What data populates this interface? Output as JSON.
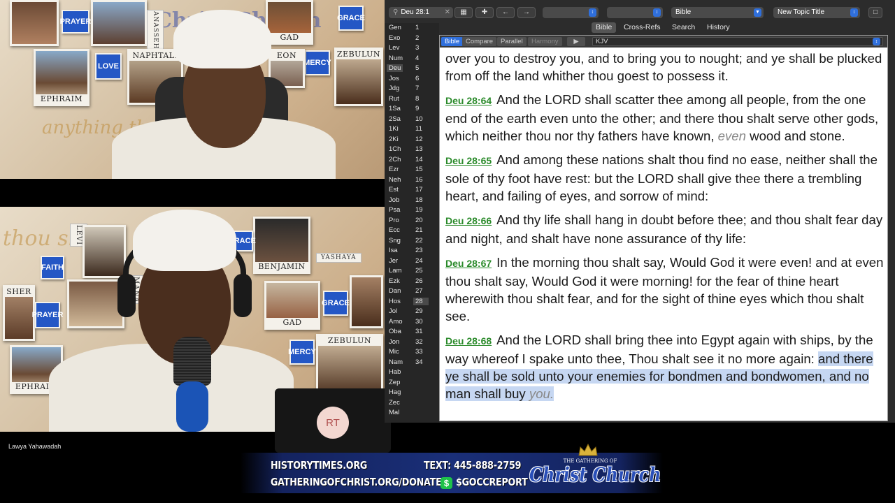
{
  "video_call": {
    "participant_name": "Lawya Yahawadah",
    "avatar_initials": "RT",
    "top_wall": {
      "tags": [
        "PRAYER",
        "LOVE",
        "GRACE",
        "MERCY"
      ],
      "photo_labels": [
        "EPHRAIM",
        "NAPHTALI",
        "GAD",
        "ZEBULUN",
        "EON"
      ],
      "side_label": "ANASSEH",
      "wall_title": "Christ Church",
      "wall_script": "anything that is"
    },
    "bottom_wall": {
      "tags": [
        "FAITH",
        "PRAYER",
        "MERCY",
        "GRACE"
      ],
      "photo_labels": [
        "BENJAMIN",
        "GAD",
        "ZEBULUN",
        "EPHRAIM"
      ],
      "side_labels": [
        "LEVI",
        "MANA",
        "SHER",
        "YASHAYA"
      ],
      "wall_script": "thou shalt"
    }
  },
  "bible_app": {
    "reference_field": "Deu 28:1",
    "module_select": "Bible",
    "layout_select": "New Topic Title",
    "top_tabs": [
      "Bible",
      "Cross-Refs",
      "Search",
      "History"
    ],
    "active_top_tab": "Bible",
    "sub_tabs": [
      "Bible",
      "Compare",
      "Parallel",
      "Harmony"
    ],
    "version": "KJV",
    "books": [
      {
        "name": "Gen",
        "ch": "1"
      },
      {
        "name": "Exo",
        "ch": "2"
      },
      {
        "name": "Lev",
        "ch": "3"
      },
      {
        "name": "Num",
        "ch": "4"
      },
      {
        "name": "Deu",
        "ch": "5"
      },
      {
        "name": "Jos",
        "ch": "6"
      },
      {
        "name": "Jdg",
        "ch": "7"
      },
      {
        "name": "Rut",
        "ch": "8"
      },
      {
        "name": "1Sa",
        "ch": "9"
      },
      {
        "name": "2Sa",
        "ch": "10"
      },
      {
        "name": "1Ki",
        "ch": "11"
      },
      {
        "name": "2Ki",
        "ch": "12"
      },
      {
        "name": "1Ch",
        "ch": "13"
      },
      {
        "name": "2Ch",
        "ch": "14"
      },
      {
        "name": "Ezr",
        "ch": "15"
      },
      {
        "name": "Neh",
        "ch": "16"
      },
      {
        "name": "Est",
        "ch": "17"
      },
      {
        "name": "Job",
        "ch": "18"
      },
      {
        "name": "Psa",
        "ch": "19"
      },
      {
        "name": "Pro",
        "ch": "20"
      },
      {
        "name": "Ecc",
        "ch": "21"
      },
      {
        "name": "Sng",
        "ch": "22"
      },
      {
        "name": "Isa",
        "ch": "23"
      },
      {
        "name": "Jer",
        "ch": "24"
      },
      {
        "name": "Lam",
        "ch": "25"
      },
      {
        "name": "Ezk",
        "ch": "26"
      },
      {
        "name": "Dan",
        "ch": "27"
      },
      {
        "name": "Hos",
        "ch": "28"
      },
      {
        "name": "Jol",
        "ch": "29"
      },
      {
        "name": "Amo",
        "ch": "30"
      },
      {
        "name": "Oba",
        "ch": "31"
      },
      {
        "name": "Jon",
        "ch": "32"
      },
      {
        "name": "Mic",
        "ch": "33"
      },
      {
        "name": "Nam",
        "ch": "34"
      },
      {
        "name": "Hab",
        "ch": ""
      },
      {
        "name": "Zep",
        "ch": ""
      },
      {
        "name": "Hag",
        "ch": ""
      },
      {
        "name": "Zec",
        "ch": ""
      },
      {
        "name": "Mal",
        "ch": ""
      }
    ],
    "selected_book": "Deu",
    "selected_chapter": "28",
    "partial_verse_text": "over you to destroy you, and to bring you to nought; and ye shall be plucked from off the land whither thou goest to possess it.",
    "verses": [
      {
        "ref": "Deu 28:64",
        "text": "And the LORD shall scatter thee among all people, from the one end of the earth even unto the other; and there thou shalt serve other gods, which neither thou nor thy fathers have known,",
        "italic": "even",
        "tail": " wood and stone."
      },
      {
        "ref": "Deu 28:65",
        "text": "And among these nations shalt thou find no ease, neither shall the sole of thy foot have rest: but the LORD shall give thee there a trembling heart, and failing of eyes, and sorrow of mind:"
      },
      {
        "ref": "Deu 28:66",
        "text": "And thy life shall hang in doubt before thee; and thou shalt fear day and night, and shalt have none assurance of thy life:"
      },
      {
        "ref": "Deu 28:67",
        "text": "In the morning thou shalt say, Would God it were even! and at even thou shalt say, Would God it were morning! for the fear of thine heart wherewith thou shalt fear, and for the sight of thine eyes which thou shalt see."
      },
      {
        "ref": "Deu 28:68",
        "text": "And the LORD shall bring thee into Egypt again with ships, by the way whereof I spake unto thee, Thou shalt see it no more again:",
        "highlight": "and there ye shall be sold unto your enemies for bondmen and bondwomen, and no man shall buy",
        "italic": "you."
      }
    ]
  },
  "banner": {
    "website": "HISTORYTIMES.ORG",
    "donate": "GATHERINGOFCHRIST.ORG/DONATE",
    "text_line": "TEXT: 445-888-2759",
    "cashtag": "$GOCCREPORT",
    "dollar_symbol": "$",
    "logo_small": "THE GATHERING OF",
    "logo_main": "Christ Church"
  },
  "colors": {
    "accent_blue": "#2f6fdc",
    "verse_ref_green": "#2a8a2a",
    "highlight": "#c6d7f2",
    "banner_navy": "#1a2f78",
    "tag_blue": "#2457c5"
  }
}
